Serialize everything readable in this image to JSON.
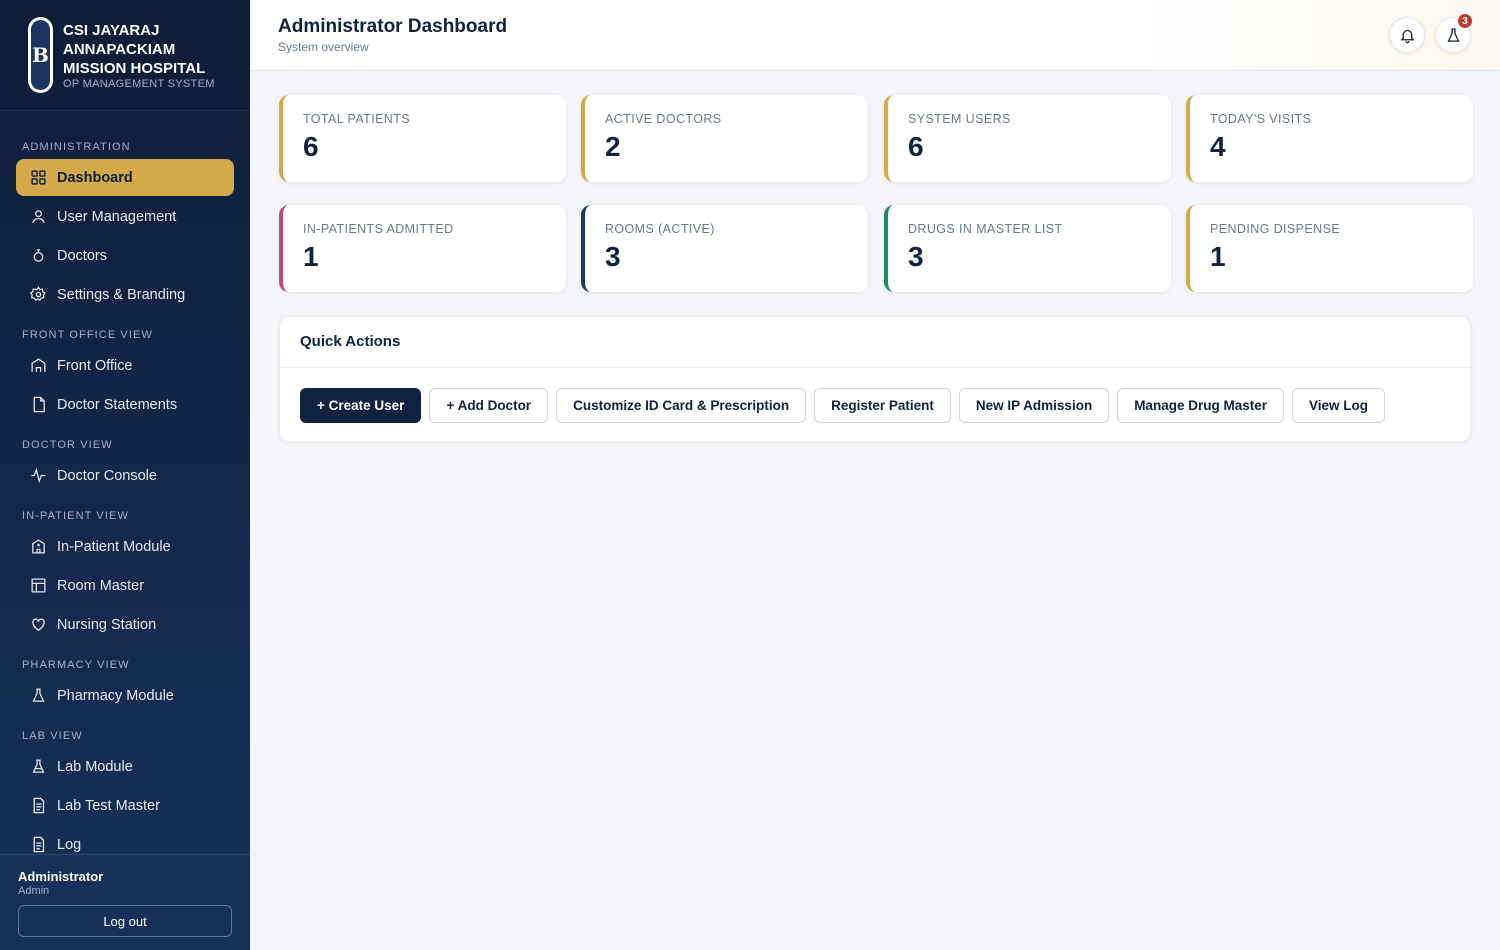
{
  "brand": {
    "logo_letter": "B",
    "name": "CSI JAYARAJ ANNAPACKIAM MISSION HOSPITAL",
    "subtitle": "OP MANAGEMENT SYSTEM"
  },
  "nav": {
    "sections": [
      {
        "label": "ADMINISTRATION",
        "items": [
          {
            "label": "Dashboard",
            "icon": "grid-icon",
            "active": true
          },
          {
            "label": "User Management",
            "icon": "user-icon"
          },
          {
            "label": "Doctors",
            "icon": "stethoscope-icon"
          },
          {
            "label": "Settings & Branding",
            "icon": "gear-icon"
          }
        ]
      },
      {
        "label": "FRONT OFFICE VIEW",
        "items": [
          {
            "label": "Front Office",
            "icon": "building-icon"
          },
          {
            "label": "Doctor Statements",
            "icon": "document-icon"
          }
        ]
      },
      {
        "label": "DOCTOR VIEW",
        "items": [
          {
            "label": "Doctor Console",
            "icon": "pulse-icon"
          }
        ]
      },
      {
        "label": "IN-PATIENT VIEW",
        "items": [
          {
            "label": "In-Patient Module",
            "icon": "hospital-icon"
          },
          {
            "label": "Room Master",
            "icon": "layout-icon"
          },
          {
            "label": "Nursing Station",
            "icon": "heart-icon"
          }
        ]
      },
      {
        "label": "PHARMACY VIEW",
        "items": [
          {
            "label": "Pharmacy Module",
            "icon": "flask-icon"
          }
        ]
      },
      {
        "label": "LAB VIEW",
        "items": [
          {
            "label": "Lab Module",
            "icon": "beaker-icon"
          },
          {
            "label": "Lab Test Master",
            "icon": "list-doc-icon"
          },
          {
            "label": "Log",
            "icon": "log-icon"
          }
        ]
      }
    ]
  },
  "user": {
    "name": "Administrator",
    "role": "Admin",
    "logout_label": "Log out"
  },
  "header": {
    "title": "Administrator Dashboard",
    "subtitle": "System overview",
    "lab_badge_count": "3"
  },
  "stats": [
    {
      "label": "TOTAL PATIENTS",
      "value": "6",
      "color": "#d4a94a"
    },
    {
      "label": "ACTIVE DOCTORS",
      "value": "2",
      "color": "#d4a94a"
    },
    {
      "label": "SYSTEM USERS",
      "value": "6",
      "color": "#d4a94a"
    },
    {
      "label": "TODAY'S VISITS",
      "value": "4",
      "color": "#d4a94a"
    },
    {
      "label": "IN-PATIENTS ADMITTED",
      "value": "1",
      "color": "#c2497a"
    },
    {
      "label": "ROOMS (ACTIVE)",
      "value": "3",
      "color": "#1a3a6b"
    },
    {
      "label": "DRUGS IN MASTER LIST",
      "value": "3",
      "color": "#1f8a5c"
    },
    {
      "label": "PENDING DISPENSE",
      "value": "1",
      "color": "#d4a94a"
    }
  ],
  "quick_actions": {
    "title": "Quick Actions",
    "buttons": [
      "+ Create User",
      "+ Add Doctor",
      "Customize ID Card & Prescription",
      "Register Patient",
      "New IP Admission",
      "Manage Drug Master",
      "View Log"
    ]
  }
}
